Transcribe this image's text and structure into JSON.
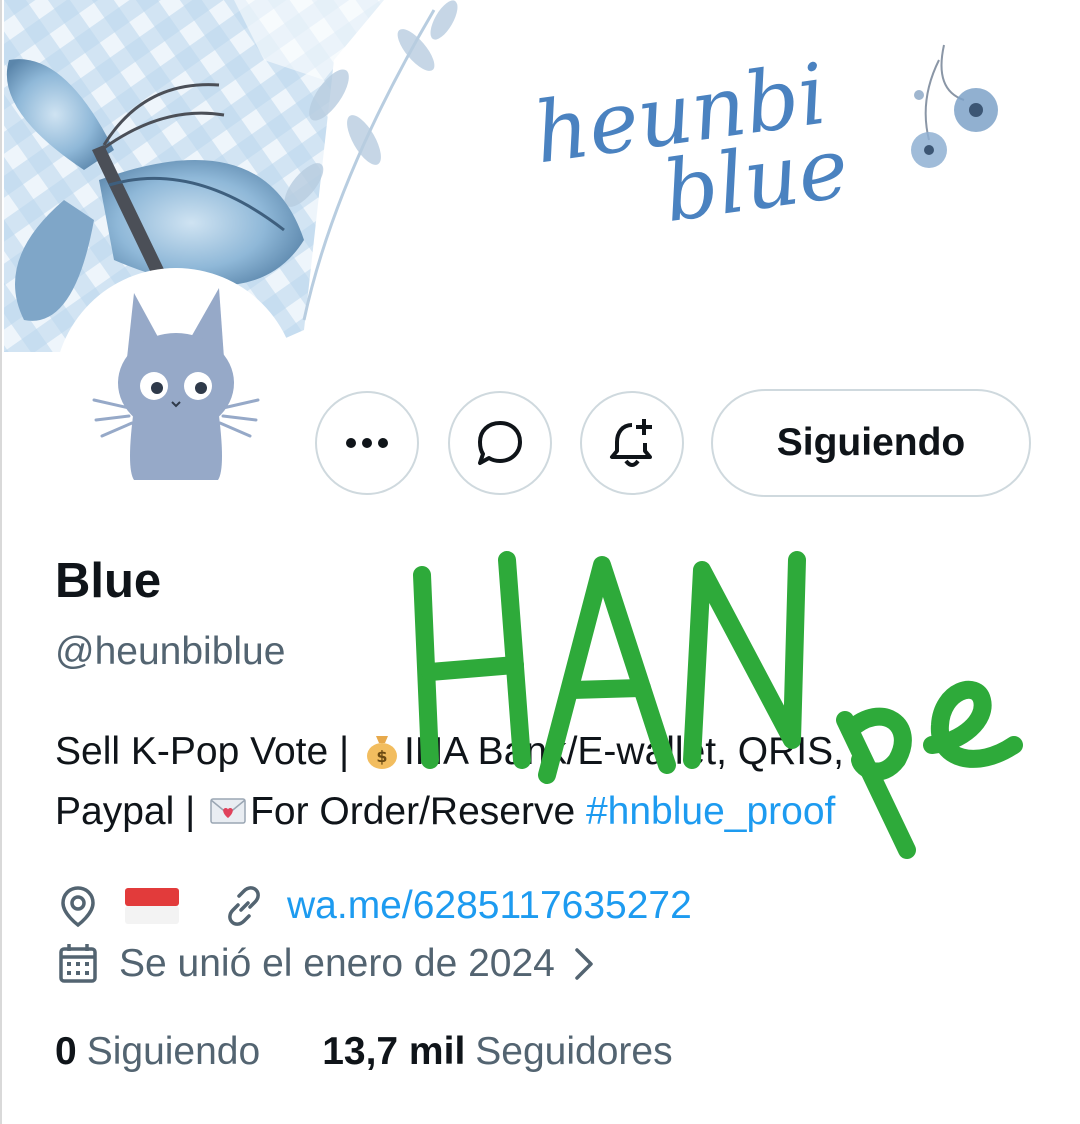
{
  "banner": {
    "logo_text_line1": "heunbi",
    "logo_text_line2": "blue"
  },
  "profile": {
    "name": "Blue",
    "handle": "@heunbiblue",
    "bio_line1_a": "Sell K-Pop Vote | ",
    "bio_line1_b": "INA Bank/E-wallet, QRIS,",
    "bio_line2_a": "Paypal | ",
    "bio_line2_b": "For Order/Reserve ",
    "bio_hashtag": "#hnblue_proof",
    "website": "wa.me/6285117635272",
    "joined": "Se unió el enero de 2024"
  },
  "actions": {
    "follow_label": "Siguiendo"
  },
  "stats": {
    "following_count": "0",
    "following_label": "Siguiendo",
    "followers_count": "13,7 mil",
    "followers_label": "Seguidores"
  },
  "watermark": {
    "text_main": "HAN",
    "text_sub": "pe",
    "color": "#2eaa3a"
  },
  "colors": {
    "link": "#1d9bf0",
    "secondary_text": "#536471",
    "border": "#cfd9de",
    "avatar_cat": "#96a9c8"
  },
  "icons": [
    "more-icon",
    "message-icon",
    "notification-bell-icon",
    "location-icon",
    "flag-icon",
    "link-icon",
    "calendar-icon",
    "chevron-right-icon",
    "money-bag-emoji",
    "love-letter-emoji"
  ]
}
